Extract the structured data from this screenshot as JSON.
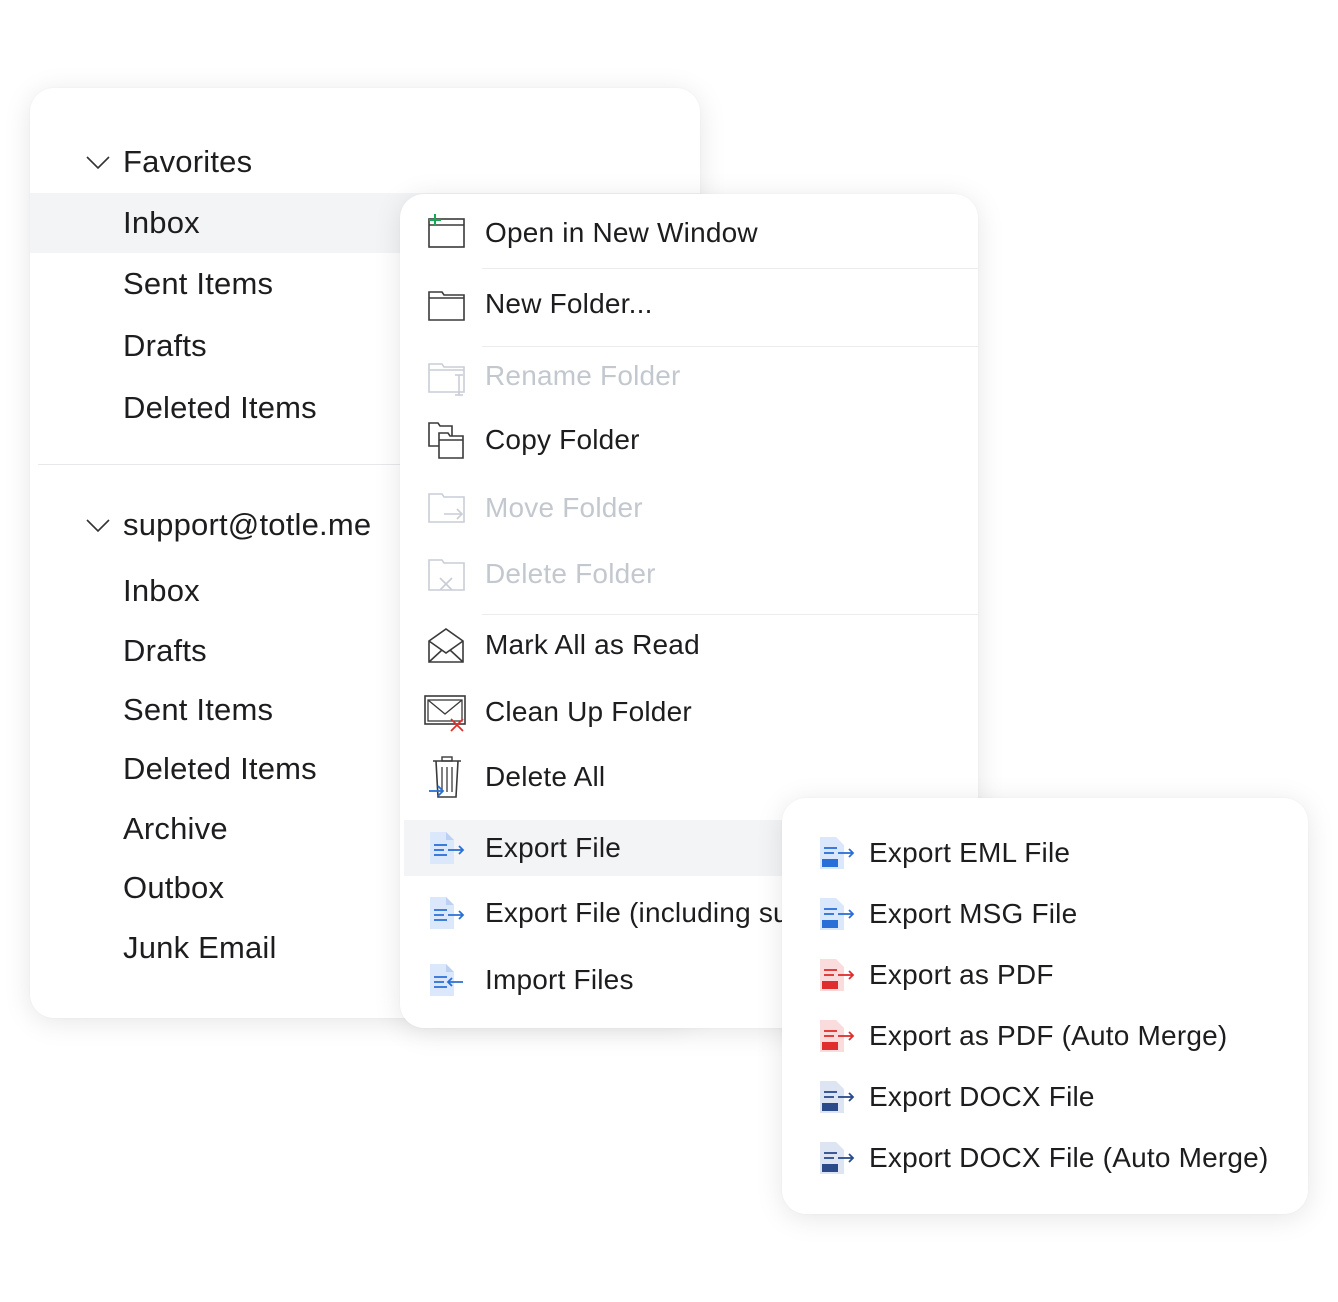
{
  "favorites": {
    "title": "Favorites",
    "items": [
      "Inbox",
      "Sent Items",
      "Drafts",
      "Deleted Items"
    ],
    "selected": "Inbox"
  },
  "account": {
    "title": "support@totle.me",
    "items": [
      "Inbox",
      "Drafts",
      "Sent Items",
      "Deleted Items",
      "Archive",
      "Outbox",
      "Junk Email"
    ]
  },
  "context_menu": {
    "items": [
      {
        "label": "Open in New Window",
        "icon": "window-plus-icon",
        "enabled": true
      },
      {
        "label": "New Folder...",
        "icon": "folder-icon",
        "enabled": true
      },
      {
        "label": "Rename Folder",
        "icon": "folder-rename-icon",
        "enabled": false
      },
      {
        "label": "Copy Folder",
        "icon": "folder-copy-icon",
        "enabled": true
      },
      {
        "label": "Move Folder",
        "icon": "folder-move-icon",
        "enabled": false
      },
      {
        "label": "Delete Folder",
        "icon": "folder-delete-icon",
        "enabled": false
      },
      {
        "label": "Mark All as Read",
        "icon": "envelope-open-icon",
        "enabled": true
      },
      {
        "label": "Clean Up Folder",
        "icon": "envelope-clean-icon",
        "enabled": true
      },
      {
        "label": "Delete All",
        "icon": "trash-icon",
        "enabled": true
      },
      {
        "label": "Export File",
        "icon": "file-export-icon",
        "enabled": true,
        "highlighted": true
      },
      {
        "label": "Export File (including su",
        "icon": "file-export-icon",
        "enabled": true
      },
      {
        "label": "Import Files",
        "icon": "file-import-icon",
        "enabled": true
      }
    ]
  },
  "export_submenu": {
    "items": [
      {
        "label": "Export EML File",
        "icon": "eml-file-icon",
        "color": "#2a6fd8"
      },
      {
        "label": "Export MSG File",
        "icon": "msg-file-icon",
        "color": "#2a6fd8"
      },
      {
        "label": "Export as PDF",
        "icon": "pdf-file-icon",
        "color": "#e02d2d"
      },
      {
        "label": "Export as PDF (Auto Merge)",
        "icon": "pdf-file-icon",
        "color": "#e02d2d"
      },
      {
        "label": "Export DOCX File",
        "icon": "docx-file-icon",
        "color": "#2b4a8a"
      },
      {
        "label": "Export DOCX File (Auto Merge)",
        "icon": "docx-file-icon",
        "color": "#2b4a8a"
      }
    ]
  },
  "colors": {
    "accent_blue": "#2a6fd8",
    "accent_green": "#1aa655",
    "danger_red": "#e02d2d",
    "disabled_text": "#c3c8cf",
    "hover_bg": "#f3f4f6"
  }
}
